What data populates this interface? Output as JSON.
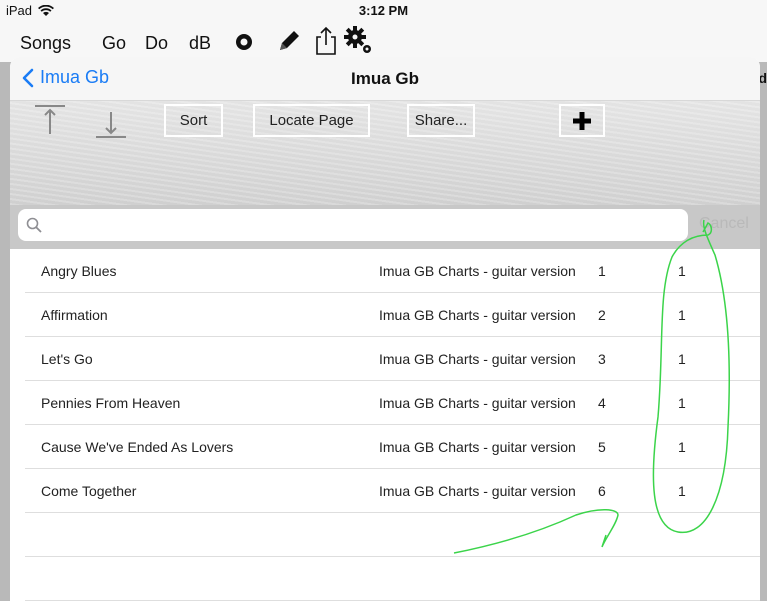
{
  "status": {
    "device": "iPad",
    "time": "3:12 PM"
  },
  "app_toolbar": {
    "songs": "Songs",
    "go": "Go",
    "do": "Do",
    "db": "dB"
  },
  "nav": {
    "back_label": "Imua Gb",
    "title": "Imua Gb"
  },
  "toolbar": {
    "sort": "Sort",
    "locate": "Locate Page",
    "share": "Share..."
  },
  "search": {
    "placeholder": "",
    "value": "",
    "cancel": "Cancel"
  },
  "rows": [
    {
      "title": "Angry Blues",
      "source": "Imua GB Charts - guitar version",
      "num": "1",
      "page": "1"
    },
    {
      "title": "Affirmation",
      "source": "Imua GB Charts - guitar version",
      "num": "2",
      "page": "1"
    },
    {
      "title": "Let's Go",
      "source": "Imua GB Charts - guitar version",
      "num": "3",
      "page": "1"
    },
    {
      "title": "Pennies From Heaven",
      "source": "Imua GB Charts - guitar version",
      "num": "4",
      "page": "1"
    },
    {
      "title": "Cause We've Ended As Lovers",
      "source": "Imua GB Charts - guitar version",
      "num": "5",
      "page": "1"
    },
    {
      "title": "Come Together",
      "source": "Imua GB Charts - guitar version",
      "num": "6",
      "page": "1"
    }
  ],
  "colors": {
    "accent": "#1a7cf5",
    "annotation": "#3bd44a"
  }
}
